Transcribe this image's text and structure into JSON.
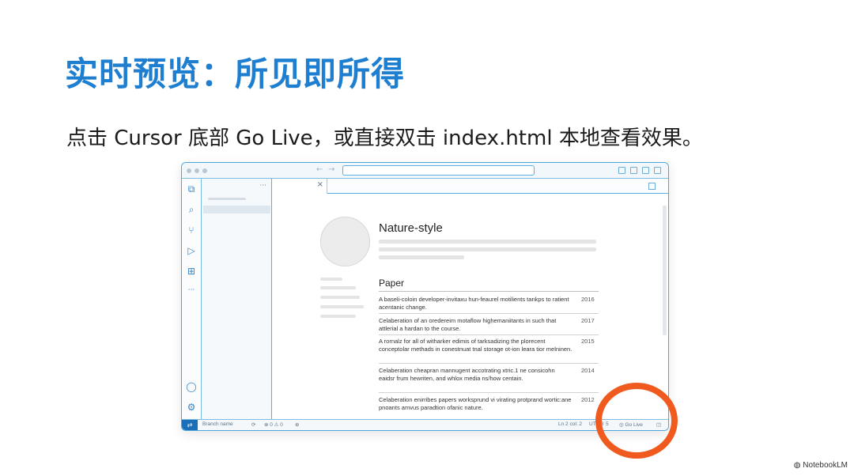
{
  "slide": {
    "title": "实时预览：所见即所得",
    "subtitle": "点击 Cursor 底部 Go Live，或直接双击 index.html 本地查看效果。"
  },
  "window": {
    "explorer": {
      "more": "···"
    },
    "tab": {
      "close": "×"
    },
    "activity": {
      "files": "⧉",
      "search": "⌕",
      "git": "⑂",
      "run": "▷",
      "extensions": "⊞",
      "more": "···",
      "account": "◯",
      "settings": "⚙"
    },
    "nav": {
      "back": "←",
      "forward": "→"
    }
  },
  "preview": {
    "name": "Nature-style",
    "section": "Paper",
    "papers": [
      {
        "text": "A baseli-coloin developer-invitaxu hun-feaurel motilients tankps to ratient acentanic change.",
        "year": "2016"
      },
      {
        "text": "Celaberation of an oredereim motaflow highemaniitants in such that attlerial a hardan to the course.",
        "year": "2017"
      },
      {
        "text": "A rornalz for all of witharker edimis of tarksadizing the plorecent conceptolar methads in conestnuat tnal storage ot-ion leara tior melninen.",
        "year": "2015"
      },
      {
        "text": "Celaberation cheapran mannugent accotrating xtric.1 ne consicohn eaidsr frum hewriten, and whlox media ns/how centain.",
        "year": "2014"
      },
      {
        "text": "Celaberation enirribes papers worksprund vi virating protprand wortic:ane pnoants amvus paradtion ofanic nature.",
        "year": "2012"
      }
    ]
  },
  "statusbar": {
    "remote": "⇄",
    "branch": "Branch name",
    "sync": "⟳",
    "problems": "⊗ 0 ⚠ 0",
    "ports": "⊕",
    "position": "Ln 2 col: 2",
    "encoding": "UTF-8",
    "spaces": "5",
    "go_live": "Go Live",
    "notify": "◫"
  },
  "watermark": "NotebookLM"
}
